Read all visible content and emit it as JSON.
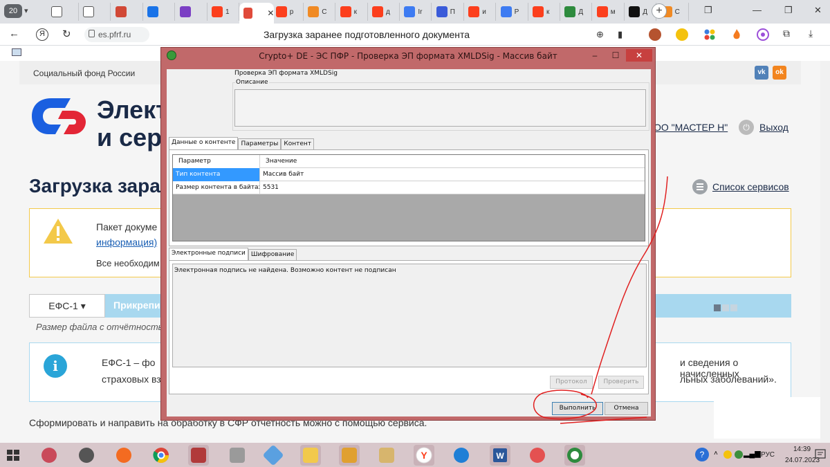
{
  "browser": {
    "tab_count": "20",
    "tabs": [
      {
        "title": "",
        "color": "#ffffff",
        "icon": "document-icon"
      },
      {
        "title": "",
        "color": "#ffffff",
        "icon": "document-icon"
      },
      {
        "title": "",
        "color": "#d14836",
        "icon": "bar-chart-icon"
      },
      {
        "title": "",
        "color": "#1a73e8",
        "icon": "compass-icon"
      },
      {
        "title": "",
        "color": "#7b3fc4",
        "icon": "bars-icon"
      },
      {
        "title": "1",
        "color": "#fc3f1d",
        "icon": "yandex-icon"
      },
      {
        "title": "",
        "color": "#e04a3a",
        "icon": "sfr-icon"
      },
      {
        "title": "р",
        "color": "#fc3f1d",
        "icon": "yandex-icon"
      },
      {
        "title": "С",
        "color": "#f08a24",
        "icon": "flame-icon"
      },
      {
        "title": "к",
        "color": "#fc3f1d",
        "icon": "yandex-icon"
      },
      {
        "title": "д",
        "color": "#fc3f1d",
        "icon": "yandex-icon"
      },
      {
        "title": "Ir",
        "color": "#3d7bf2",
        "icon": "cube-icon"
      },
      {
        "title": "П",
        "color": "#3a5bd9",
        "icon": "diagonal-icon"
      },
      {
        "title": "и",
        "color": "#fc3f1d",
        "icon": "yandex-icon"
      },
      {
        "title": "Р",
        "color": "#3d7bf2",
        "icon": "cube-icon"
      },
      {
        "title": "к",
        "color": "#fc3f1d",
        "icon": "yandex-icon"
      },
      {
        "title": "Д",
        "color": "#2e8b3e",
        "icon": "dollar-icon"
      },
      {
        "title": "м",
        "color": "#fc3f1d",
        "icon": "yandex-icon"
      },
      {
        "title": "Д",
        "color": "#111111",
        "icon": "star-icon"
      },
      {
        "title": "С",
        "color": "#f08a24",
        "icon": "flame-icon"
      }
    ],
    "url": "es.pfrf.ru",
    "page_title": "Загрузка заранее подготовленного документа"
  },
  "page": {
    "org_name": "Социальный фонд России",
    "vk_label": "vk",
    "ok_label": "ok",
    "title_line1": "Электр",
    "title_line2": "и серв",
    "org_link": "ОО \"МАСТЕР Н\"",
    "exit_link": "Выход",
    "heading": "Загрузка заран",
    "services_link": "Список сервисов",
    "warning_line1": "Пакет докуме",
    "warning_link": "информация)",
    "warning_line3": "Все необходим",
    "efs_dropdown": "ЕФС-1 ▾",
    "attach_label": "Прикрепи",
    "size_note": "Размер файла с отчётностью",
    "info_line1": "ЕФС-1 – фо",
    "info_line2": "страховых вз",
    "info_line1_right": "и сведения о начисленных",
    "info_line2_right": "льных заболеваний».",
    "bottom_text": "Сформировать и направить на обработку в СФР отчетность можно с помощью сервиса."
  },
  "dialog": {
    "title": "Crypto+ DE - ЭС ПФР - Проверка ЭП формата XMLDSig - Массив байт",
    "minimize": "‒",
    "maximize": "☐",
    "close": "✕",
    "check_title": "Проверка ЭП формата XMLDSig",
    "description_label": "Описание",
    "tabs_top": [
      "Данные о контенте",
      "Параметры",
      "Контент"
    ],
    "grid_headers": [
      "Параметр",
      "Значение"
    ],
    "grid_rows": [
      {
        "param": "Тип контента",
        "value": "Массив байт"
      },
      {
        "param": "Размер контента в байтах",
        "value": "5531"
      }
    ],
    "tabs_bottom": [
      "Электронные подписи",
      "Шифрование"
    ],
    "signature_message": "Электронная подпись не найдена. Возможно контент не подписан",
    "protocol_button": "Протокол",
    "verify_button": "Проверить",
    "execute_button": "Выполнить",
    "cancel_button": "Отмена"
  },
  "taskbar": {
    "language": "РУС",
    "time": "14:39",
    "date": "24.07.2023"
  }
}
